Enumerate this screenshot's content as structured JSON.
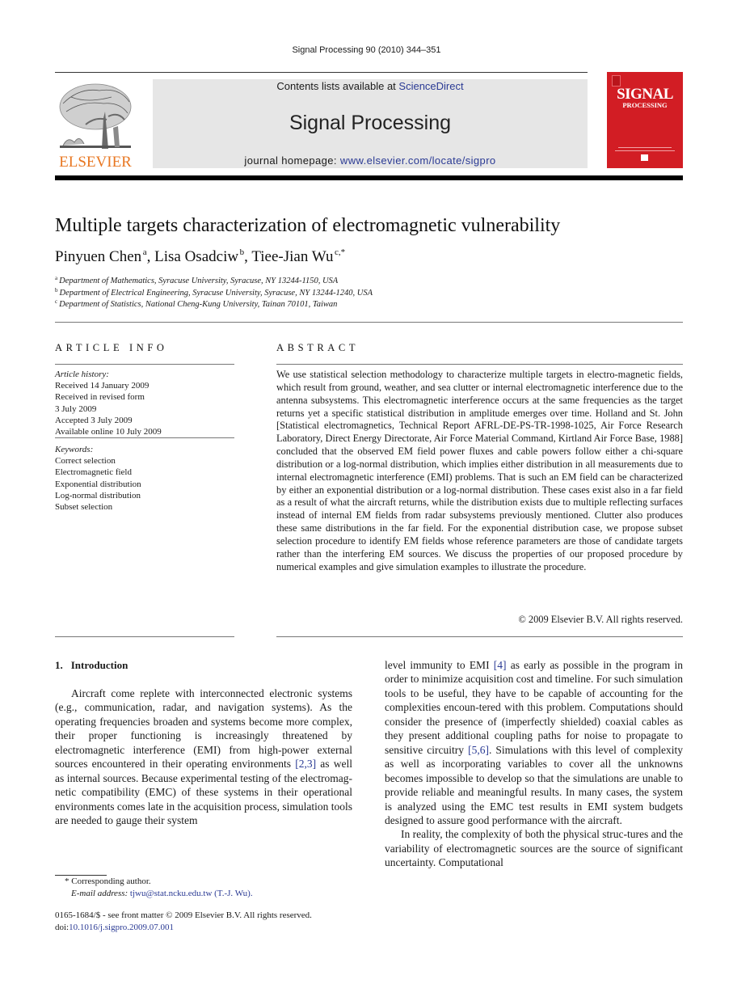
{
  "running_head": "Signal Processing 90 (2010) 344–351",
  "masthead": {
    "contents_prefix": "Contents lists available at ",
    "contents_link": "ScienceDirect",
    "journal_name": "Signal Processing",
    "homepage_prefix": "journal homepage: ",
    "homepage_link": "www.elsevier.com/locate/sigpro",
    "publisher_logo_text": "ELSEVIER",
    "cover_title_line1": "SIGNAL",
    "cover_title_line2": "PROCESSING",
    "colors": {
      "publisher_orange": "#e87722",
      "cover_red": "#d21d24",
      "link_blue": "#2a3a94",
      "masthead_gray": "#e6e6e6"
    }
  },
  "article": {
    "title": "Multiple targets characterization of electromagnetic vulnerability",
    "authors": [
      {
        "name": "Pinyuen Chen",
        "marks": "a",
        "sep": ", "
      },
      {
        "name": "Lisa Osadciw",
        "marks": "b",
        "sep": ", "
      },
      {
        "name": "Tiee-Jian Wu",
        "marks": "c,*",
        "sep": ""
      }
    ],
    "affiliations": [
      {
        "mark": "a",
        "text": "Department of Mathematics, Syracuse University, Syracuse, NY 13244-1150, USA"
      },
      {
        "mark": "b",
        "text": "Department of Electrical Engineering, Syracuse University, Syracuse, NY 13244-1240, USA"
      },
      {
        "mark": "c",
        "text": "Department of Statistics, National Cheng-Kung University, Tainan 70101, Taiwan"
      }
    ]
  },
  "article_info": {
    "heading": "ARTICLE INFO",
    "history_label": "Article history:",
    "history": [
      "Received 14 January 2009",
      "Received in revised form",
      "3 July 2009",
      "Accepted 3 July 2009",
      "Available online 10 July 2009"
    ],
    "keywords_label": "Keywords:",
    "keywords": [
      "Correct selection",
      "Electromagnetic field",
      "Exponential distribution",
      "Log-normal distribution",
      "Subset selection"
    ]
  },
  "abstract": {
    "heading": "ABSTRACT",
    "text": "We use statistical selection methodology to characterize multiple targets in electro-magnetic fields, which result from ground, weather, and sea clutter or internal electromagnetic interference due to the antenna subsystems. This electromagnetic interference occurs at the same frequencies as the target returns yet a specific statistical distribution in amplitude emerges over time. Holland and St. John [Statistical electromagnetics, Technical Report AFRL-DE-PS-TR-1998-1025, Air Force Research Laboratory, Direct Energy Directorate, Air Force Material Command, Kirtland Air Force Base, 1988] concluded that the observed EM field power fluxes and cable powers follow either a chi-square distribution or a log-normal distribution, which implies either distribution in all measurements due to internal electromagnetic interference (EMI) problems. That is such an EM field can be characterized by either an exponential distribution or a log-normal distribution. These cases exist also in a far field as a result of what the aircraft returns, while the distribution exists due to multiple reflecting surfaces instead of internal EM fields from radar subsystems previously mentioned. Clutter also produces these same distributions in the far field. For the exponential distribution case, we propose subset selection procedure to identify EM fields whose reference parameters are those of candidate targets rather than the interfering EM sources. We discuss the properties of our proposed procedure by numerical examples and give simulation examples to illustrate the procedure.",
    "copyright": "© 2009 Elsevier B.V. All rights reserved."
  },
  "introduction": {
    "number": "1.",
    "heading": "Introduction",
    "left_column": {
      "p1_a": "Aircraft come replete with interconnected electronic systems (e.g., communication, radar, and navigation systems). As the operating frequencies broaden and systems become more complex, their proper functioning is increasingly threatened by electromagnetic interference (EMI) from high-power external sources encountered in their operating environments ",
      "p1_ref1": "[2,3]",
      "p1_b": " as well as internal sources. Because experimental testing of the electromag-netic compatibility (EMC) of these systems in their operational environments comes late in the acquisition process, simulation tools are needed to gauge their system"
    },
    "right_column": {
      "p1_c": "level immunity to EMI ",
      "p1_ref2": "[4]",
      "p1_d": " as early as possible in the program in order to minimize acquisition cost and timeline. For such simulation tools to be useful, they have to be capable of accounting for the complexities encoun-tered with this problem. Computations should consider the presence of (imperfectly shielded) coaxial cables as they present additional coupling paths for noise to propagate to sensitive circuitry ",
      "p1_ref3": "[5,6]",
      "p1_e": ". Simulations with this level of complexity as well as incorporating variables to cover all the unknowns becomes impossible to develop so that the simulations are unable to provide reliable and meaningful results. In many cases, the system is analyzed using the EMC test results in EMI system budgets designed to assure good performance with the aircraft.",
      "p2": "In reality, the complexity of both the physical struc-tures and the variability of electromagnetic sources are the source of significant uncertainty. Computational"
    }
  },
  "footnotes": {
    "corresponding_mark": "*",
    "corresponding_text": "Corresponding author.",
    "email_label": "E-mail address:",
    "email_link": "tjwu@stat.ncku.edu.tw (T.-J. Wu).",
    "front_matter": "0165-1684/$ - see front matter © 2009 Elsevier B.V. All rights reserved.",
    "doi_prefix": "doi:",
    "doi_link": "10.1016/j.sigpro.2009.07.001"
  }
}
